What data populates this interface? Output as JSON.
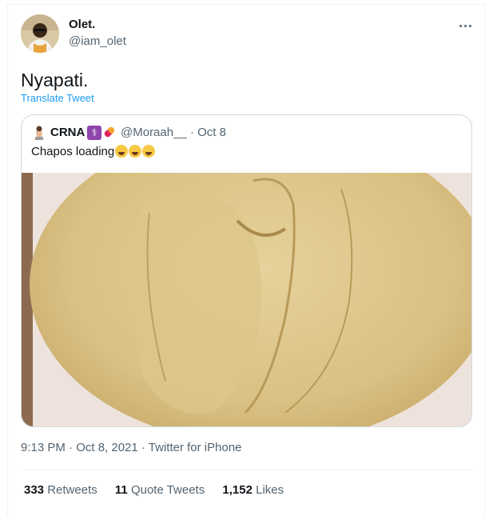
{
  "author": {
    "display_name": "Olet.",
    "handle": "@iam_olet"
  },
  "tweet": {
    "text": "Nyapati.",
    "translate_label": "Translate Tweet"
  },
  "quoted_tweet": {
    "display_name": "CRNA",
    "handle_date": "@Moraah__ · Oct 8",
    "text": "Chapos loading",
    "emoji_icons": [
      "caduceus-emoji",
      "pill-emoji",
      "laughing-emoji",
      "laughing-emoji",
      "laughing-emoji"
    ]
  },
  "meta": {
    "timestamp": "9:13 PM · Oct 8, 2021 · Twitter for iPhone"
  },
  "stats": {
    "retweets_count": "333",
    "retweets_label": "Retweets",
    "quotes_count": "11",
    "quotes_label": "Quote Tweets",
    "likes_count": "1,152",
    "likes_label": "Likes"
  },
  "colors": {
    "link": "#1d9bf0",
    "secondary_text": "#536471",
    "primary_text": "#0f1419",
    "border": "#cfd9de"
  }
}
